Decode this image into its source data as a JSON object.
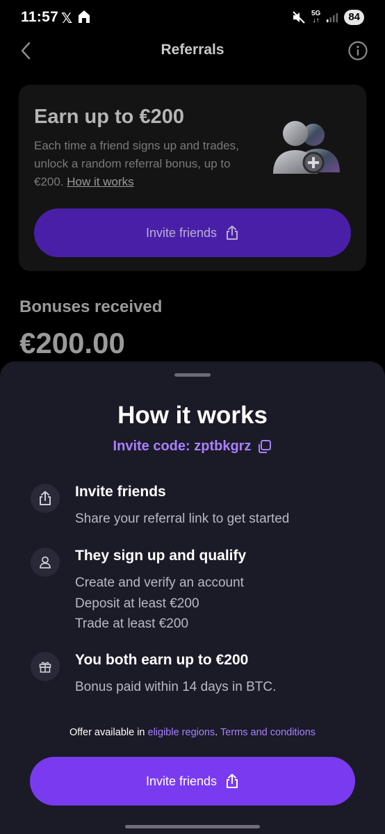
{
  "status_bar": {
    "time": "11:57",
    "x_logo": "𝕏",
    "network": "5G",
    "battery": "84"
  },
  "header": {
    "title": "Referrals",
    "back_icon": "chevron-left-icon",
    "info_icon": "info-icon"
  },
  "promo_card": {
    "title": "Earn up to €200",
    "description": "Each time a friend signs up and trades, unlock a random referral bonus, up to €200.",
    "link": "How it works",
    "button_label": "Invite friends"
  },
  "bonuses": {
    "label": "Bonuses received",
    "value": "€200.00"
  },
  "sheet": {
    "title": "How it works",
    "invite_code": "Invite code: zptbkgrz",
    "steps": [
      {
        "icon": "share-icon",
        "title": "Invite friends",
        "lines": [
          "Share your referral link to get started"
        ]
      },
      {
        "icon": "user-icon",
        "title": "They sign up and qualify",
        "lines": [
          "Create and verify an account",
          "Deposit at least €200",
          "Trade at least €200"
        ]
      },
      {
        "icon": "gift-icon",
        "title": "You both earn up to €200",
        "lines": [
          "Bonus paid within 14 days in BTC."
        ]
      }
    ],
    "offer_prefix": "Offer available in ",
    "offer_regions_link": "eligible regions",
    "offer_separator": ". ",
    "offer_terms_link": "Terms and conditions",
    "button_label": "Invite friends"
  },
  "colors": {
    "accent": "#7a3bf0",
    "accent_dim": "#4a1fa8",
    "link": "#a781ff",
    "sheet_bg": "#1b1a27"
  }
}
